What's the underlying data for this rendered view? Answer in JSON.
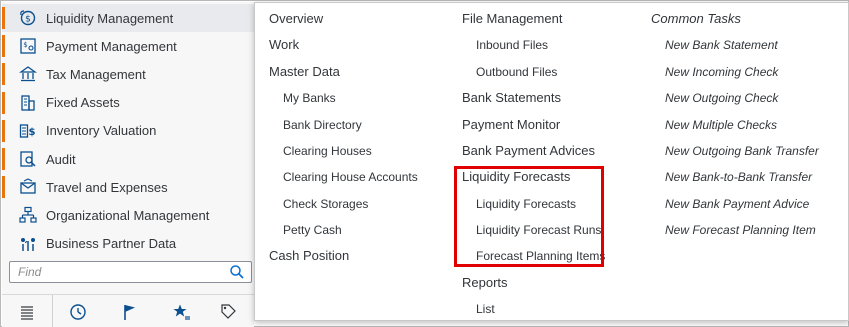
{
  "sidebar": {
    "items": [
      {
        "label": "Liquidity Management",
        "icon": "liquidity-icon"
      },
      {
        "label": "Payment Management",
        "icon": "payment-icon"
      },
      {
        "label": "Tax Management",
        "icon": "tax-icon"
      },
      {
        "label": "Fixed Assets",
        "icon": "fixed-assets-icon"
      },
      {
        "label": "Inventory Valuation",
        "icon": "inventory-icon"
      },
      {
        "label": "Audit",
        "icon": "audit-icon"
      },
      {
        "label": "Travel and Expenses",
        "icon": "travel-icon"
      },
      {
        "label": "Organizational Management",
        "icon": "org-icon"
      },
      {
        "label": "Business Partner Data",
        "icon": "partner-icon"
      }
    ],
    "find_placeholder": "Find",
    "accent_color": "#e9730c"
  },
  "bottom_bar": {
    "icons": [
      "list-icon",
      "clock-icon",
      "flag-icon",
      "favorites-icon",
      "tags-icon"
    ]
  },
  "menu": {
    "col1": {
      "overview": "Overview",
      "work": "Work",
      "master_data": "Master Data",
      "my_banks": "My Banks",
      "bank_directory": "Bank Directory",
      "clearing_houses": "Clearing Houses",
      "clearing_house_accounts": "Clearing House Accounts",
      "check_storages": "Check Storages",
      "petty_cash": "Petty Cash",
      "cash_position": "Cash Position"
    },
    "col2": {
      "file_management": "File Management",
      "inbound_files": "Inbound Files",
      "outbound_files": "Outbound Files",
      "bank_statements": "Bank Statements",
      "payment_monitor": "Payment Monitor",
      "bank_payment_advices": "Bank Payment Advices",
      "liquidity_forecasts_head": "Liquidity Forecasts",
      "liquidity_forecasts": "Liquidity Forecasts",
      "liquidity_forecast_runs": "Liquidity Forecast Runs",
      "forecast_planning_items": "Forecast Planning Items",
      "reports": "Reports",
      "list": "List"
    },
    "col3": {
      "common_tasks": "Common Tasks",
      "new_bank_statement": "New Bank Statement",
      "new_incoming_check": "New Incoming Check",
      "new_outgoing_check": "New Outgoing Check",
      "new_multiple_checks": "New Multiple Checks",
      "new_outgoing_bank_transfer": "New Outgoing Bank Transfer",
      "new_bank_to_bank_transfer": "New Bank-to-Bank Transfer",
      "new_bank_payment_advice": "New Bank Payment Advice",
      "new_forecast_planning_item": "New Forecast Planning Item"
    },
    "highlight_color": "#e00000"
  }
}
